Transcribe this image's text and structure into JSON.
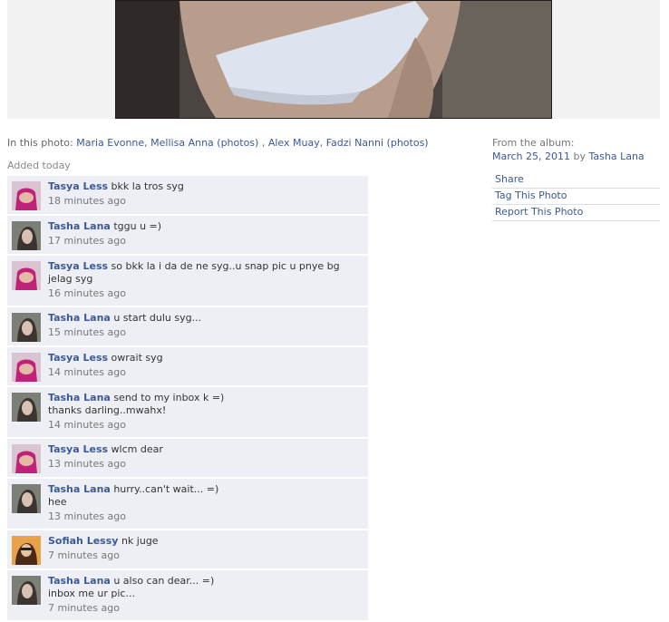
{
  "photo": {
    "alt": ""
  },
  "tags": {
    "prefix": "In this photo:",
    "people": [
      {
        "name": "Maria Evonne",
        "suffix": ","
      },
      {
        "name": "Mellisa Anna",
        "photos": "(photos)",
        "suffix": ","
      },
      {
        "name": "Alex Muay",
        "suffix": ","
      },
      {
        "name": "Fadzi Nanni",
        "photos": "(photos)",
        "suffix": ""
      }
    ]
  },
  "added_label": "Added today",
  "album": {
    "from_label": "From the album:",
    "date": "March 25, 2011",
    "by": "by",
    "owner": "Tasha Lana"
  },
  "actions": {
    "share": "Share",
    "tag": "Tag This Photo",
    "report": "Report This Photo"
  },
  "comments": [
    {
      "author": "Tasya Less",
      "text": "bkk la tros syg",
      "time": "18 minutes ago"
    },
    {
      "author": "Tasha Lana",
      "text": "tggu u =)",
      "time": "17 minutes ago"
    },
    {
      "author": "Tasya Less",
      "text": "so bkk la i da de ne syg..u snap pic u pnye bg jelag syg",
      "time": "16 minutes ago"
    },
    {
      "author": "Tasha Lana",
      "text": "u start dulu syg...",
      "time": "15 minutes ago"
    },
    {
      "author": "Tasya Less",
      "text": "owrait syg",
      "time": "14 minutes ago"
    },
    {
      "author": "Tasha Lana",
      "text": "send to my inbox k =)",
      "text2": "thanks darling..mwahx!",
      "time": "14 minutes ago"
    },
    {
      "author": "Tasya Less",
      "text": "wlcm dear",
      "time": "13 minutes ago"
    },
    {
      "author": "Tasha Lana",
      "text": "hurry..can't wait... =)",
      "text2": "hee",
      "time": "13 minutes ago"
    },
    {
      "author": "Sofiah Lessy",
      "text": "nk juge",
      "time": "7 minutes ago"
    },
    {
      "author": "Tasha Lana",
      "text": "u also can dear... =)",
      "text2": "inbox me ur pic...",
      "time": "7 minutes ago"
    }
  ]
}
